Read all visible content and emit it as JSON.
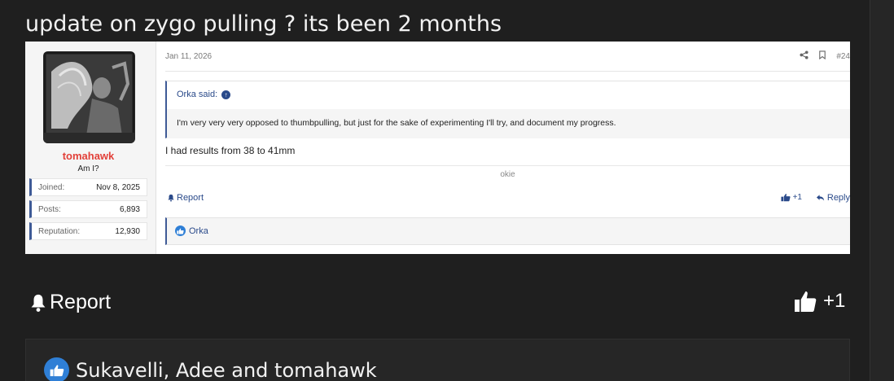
{
  "thread": {
    "title": "update on zygo pulling ? its been 2 months"
  },
  "embedded_post": {
    "author": {
      "name": "tomahawk",
      "user_title": "Am I?",
      "stats": [
        {
          "label": "Joined:",
          "value": "Nov 8, 2025"
        },
        {
          "label": "Posts:",
          "value": "6,893"
        },
        {
          "label": "Reputation:",
          "value": "12,930"
        }
      ]
    },
    "date": "Jan 11, 2026",
    "post_number": "#24",
    "quote": {
      "author_label": "Orka said:",
      "text": "I'm very very very opposed to thumbpulling, but just for the sake of experimenting I'll try, and document my progress."
    },
    "message": "I had results from 38 to 41mm",
    "signature": "okie",
    "actions": {
      "report_label": "Report",
      "like_label": "+1",
      "reply_label": "Reply"
    },
    "reactions": {
      "names": "Orka"
    }
  },
  "post_actions": {
    "report_label": "Report",
    "like_label": "+1"
  },
  "reaction_bar": {
    "names": "Sukavelli, Adee and tomahawk"
  },
  "colors": {
    "background": "#1f1f1f",
    "username": "#e2413a",
    "accent": "#3e5a96",
    "link": "#2a4a8a",
    "like": "#2f7fd6"
  },
  "icons": [
    "share-icon",
    "bookmark-icon",
    "arrow-up-circle-icon",
    "bell-icon",
    "thumbs-up-icon",
    "reply-icon",
    "like-reaction-icon"
  ]
}
